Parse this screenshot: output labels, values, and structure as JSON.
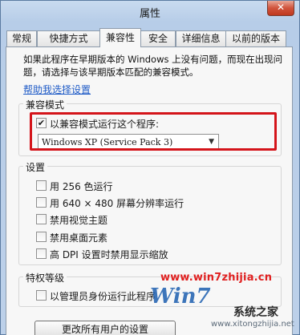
{
  "window": {
    "title": "属性",
    "close_glyph": "✕"
  },
  "tabs": [
    "常规",
    "快捷方式",
    "兼容性",
    "安全",
    "详细信息",
    "以前的版本"
  ],
  "active_tab": "兼容性",
  "intro_text": "如果此程序在早期版本的 Windows 上没有问题，而现在出现问题，请选择与该早期版本匹配的兼容模式。",
  "help_link": "帮助我选择设置",
  "compat_mode": {
    "legend": "兼容模式",
    "checkbox_label": "以兼容模式运行这个程序:",
    "checked": true,
    "selected_os": "Windows XP (Service Pack 3)"
  },
  "settings": {
    "legend": "设置",
    "options": [
      "用 256 色运行",
      "用 640 × 480 屏幕分辨率运行",
      "禁用视觉主题",
      "禁用桌面元素",
      "高 DPI 设置时禁用显示缩放"
    ]
  },
  "privilege": {
    "legend": "特权等级",
    "option": "以管理员身份运行此程序"
  },
  "all_users_button": "更改所有用户的设置",
  "watermark": {
    "url": "www.win7zhijia.cn",
    "logo": "Win7",
    "brand": "系统之家",
    "site": "www.xitongzhijia.net"
  },
  "colors": {
    "accent_red": "#d4141a",
    "link_blue": "#1f5bc7",
    "title_bar": "#b7cde8"
  }
}
